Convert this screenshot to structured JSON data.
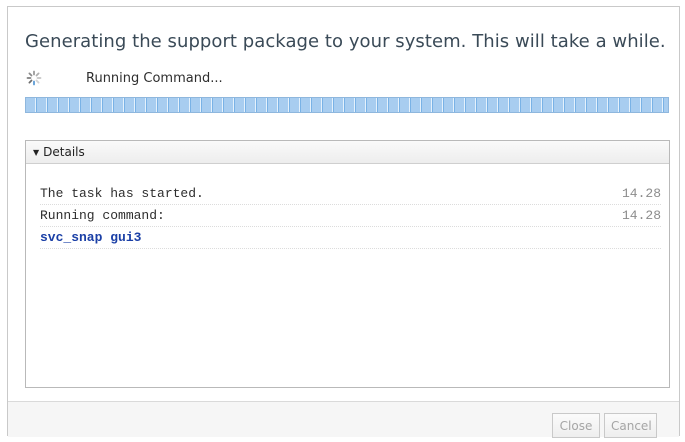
{
  "dialog": {
    "title": "Generating the support package to your system. This will take a while.",
    "status_text": "Running Command...",
    "progress_indeterminate": true,
    "spinner_icon": "spinner-icon"
  },
  "details": {
    "header_label": "Details",
    "toggle_icon": "triangle-down-icon",
    "log": [
      {
        "message": "The task has started.",
        "time": "14.28"
      },
      {
        "message": "Running command:",
        "time": "14.28"
      },
      {
        "message": "svc_snap gui3",
        "time": ""
      }
    ]
  },
  "buttons": {
    "close": "Close",
    "cancel": "Cancel"
  },
  "colors": {
    "progress_fill": "#a8cdf0",
    "command_text": "#1a3fa6",
    "title_text": "#3a4a57"
  }
}
